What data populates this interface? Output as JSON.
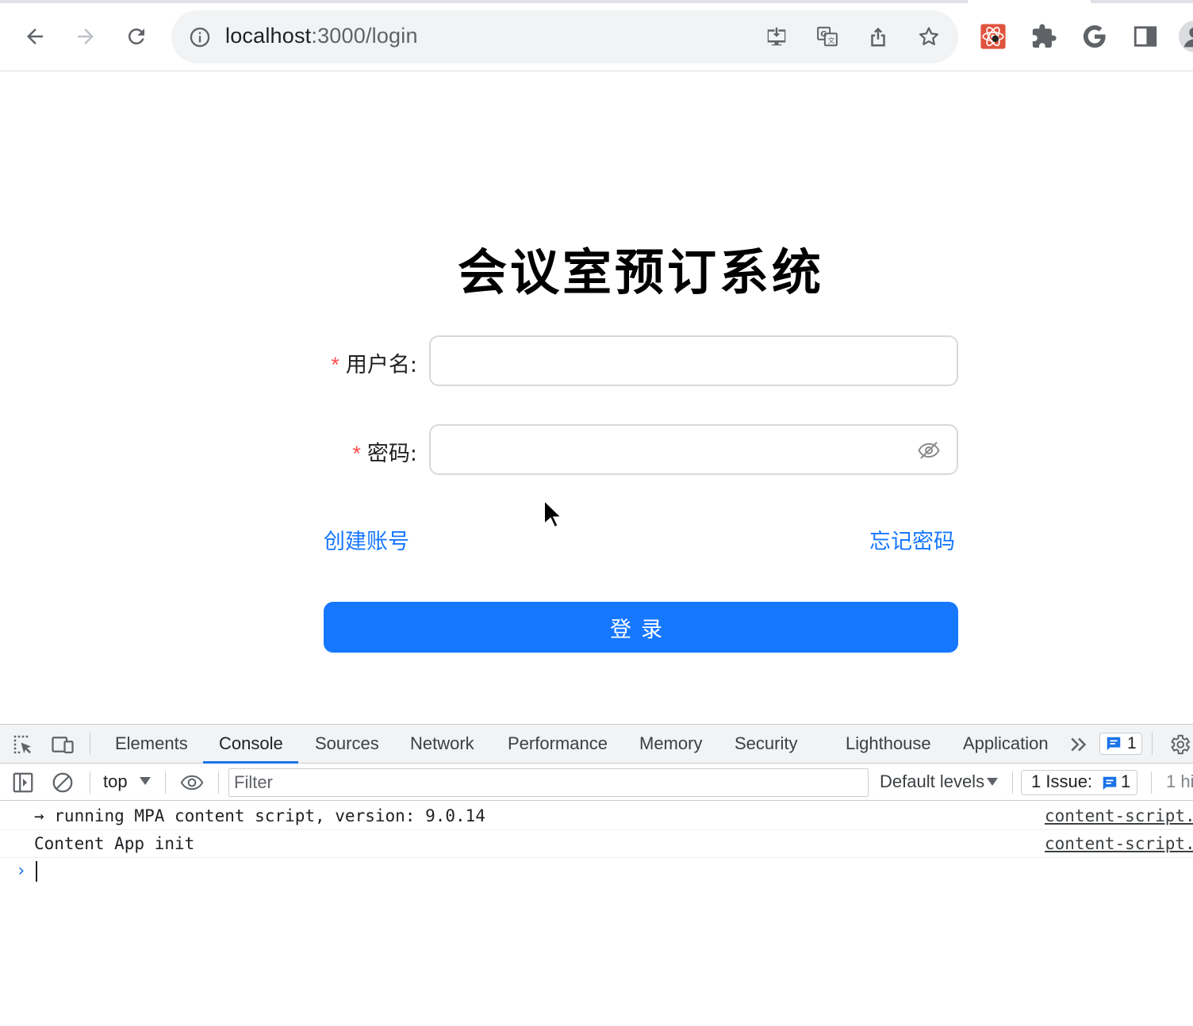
{
  "browser": {
    "url_host": "localhost",
    "url_path": ":3000/login"
  },
  "login_page": {
    "title": "会议室预订系统",
    "username_label": "用户名:",
    "password_label": "密码:",
    "required_mark": "*",
    "username_value": "",
    "password_value": "",
    "create_account_link": "创建账号",
    "forgot_password_link": "忘记密码",
    "login_button": "登录"
  },
  "devtools": {
    "tabs": [
      "Elements",
      "Console",
      "Sources",
      "Network",
      "Performance",
      "Memory",
      "Security",
      "Lighthouse",
      "Application"
    ],
    "active_tab": "Console",
    "issues_badge_count": "1",
    "context": "top",
    "filter_placeholder": "Filter",
    "default_levels": "Default levels",
    "issues_label": "1 Issue:",
    "issues_count": "1",
    "hidden_label": "1 hi",
    "logs": [
      {
        "message": "→ running MPA content script, version: 9.0.14",
        "source": "content-script."
      },
      {
        "message": "Content App init",
        "source": "content-script."
      }
    ],
    "prompt": "›"
  },
  "colors": {
    "primary": "#1677ff",
    "required": "#ff4d4f",
    "devtools_accent": "#1a73e8"
  }
}
